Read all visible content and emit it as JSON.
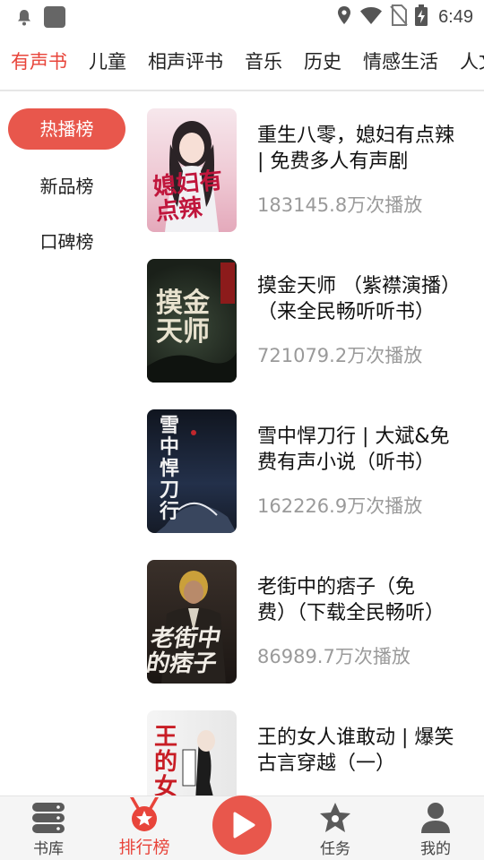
{
  "status_bar": {
    "time": "6:49",
    "icons": [
      "notification-bell-icon",
      "app-square-icon",
      "location-icon",
      "wifi-icon",
      "no-sim-icon",
      "battery-charging-icon"
    ]
  },
  "tabs": [
    {
      "label": "有声书",
      "active": true
    },
    {
      "label": "儿童",
      "active": false
    },
    {
      "label": "相声评书",
      "active": false
    },
    {
      "label": "音乐",
      "active": false
    },
    {
      "label": "历史",
      "active": false
    },
    {
      "label": "情感生活",
      "active": false
    },
    {
      "label": "人文",
      "active": false
    }
  ],
  "rank_tabs": [
    {
      "label": "热播榜",
      "active": true
    },
    {
      "label": "新品榜",
      "active": false
    },
    {
      "label": "口碑榜",
      "active": false
    }
  ],
  "books": [
    {
      "title": "重生八零，媳妇有点辣 | 免费多人有声剧",
      "plays": "183145.8万次播放",
      "cover_text": "媳妇有点辣",
      "cover_color": "#f3d3dc"
    },
    {
      "title": "摸金天师 （紫襟演播）（来全民畅听听书）",
      "plays": "721079.2万次播放",
      "cover_text": "摸金天师",
      "cover_color": "#1f2a22"
    },
    {
      "title": "雪中悍刀行 | 大斌&免费有声小说（听书）",
      "plays": "162226.9万次播放",
      "cover_text": "雪中悍刀行",
      "cover_color": "#1c2230"
    },
    {
      "title": "老街中的痞子（免费）（下载全民畅听）",
      "plays": "86989.7万次播放",
      "cover_text": "老街中的痞子",
      "cover_color": "#2a2420"
    },
    {
      "title": "王的女人谁敢动 | 爆笑古言穿越（一）",
      "plays": "",
      "cover_text": "王的女人谁敢动",
      "cover_color": "#ececec"
    }
  ],
  "bottom_nav": [
    {
      "label": "书库",
      "icon": "database-icon",
      "active": false
    },
    {
      "label": "排行榜",
      "icon": "medal-icon",
      "active": true
    },
    {
      "label": "",
      "icon": "play-icon",
      "active": false
    },
    {
      "label": "任务",
      "icon": "star-icon",
      "active": false
    },
    {
      "label": "我的",
      "icon": "user-icon",
      "active": false
    }
  ],
  "colors": {
    "accent": "#e8443a",
    "pill": "#e8574c",
    "muted": "#9a9a9a"
  }
}
